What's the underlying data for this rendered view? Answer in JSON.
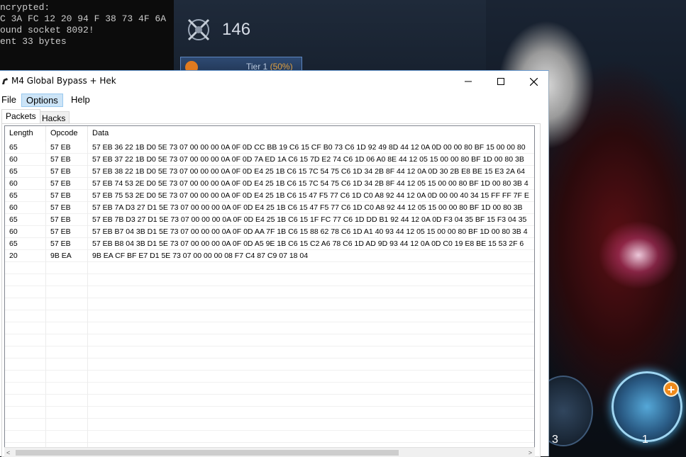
{
  "console": {
    "lines": [
      "ncrypted:",
      "C 3A FC 12 20 94 F 38 73 4F 6A",
      "ound socket 8092!",
      "ent 33 bytes"
    ]
  },
  "game": {
    "crest_count": "146",
    "tier_label": "Tier 1",
    "tier_percent": "(50%)",
    "skill_left_count": "3",
    "skill_right_count": "1",
    "skill_plus": "+"
  },
  "window": {
    "title": "M4 Global Bypass + Hek",
    "menu": {
      "file": "File",
      "options": "Options",
      "help": "Help"
    },
    "tabs": {
      "packets": "Packets",
      "hacks": "Hacks"
    }
  },
  "grid": {
    "headers": {
      "length": "Length",
      "opcode": "Opcode",
      "data": "Data"
    },
    "rows": [
      {
        "length": "65",
        "opcode": "57 EB",
        "data": "57 EB 36 22 1B D0 5E 73 07 00 00 00 0A 0F 0D CC BB 19 C6 15 CF B0 73 C6 1D 92 49 8D 44 12 0A 0D 00 00 80 BF 15 00 00 80"
      },
      {
        "length": "60",
        "opcode": "57 EB",
        "data": "57 EB 37 22 1B D0 5E 73 07 00 00 00 0A 0F 0D 7A ED 1A C6 15 7D E2 74 C6 1D 06 A0 8E 44 12 05 15 00 00 80 BF 1D 00 80 3B"
      },
      {
        "length": "65",
        "opcode": "57 EB",
        "data": "57 EB 38 22 1B D0 5E 73 07 00 00 00 0A 0F 0D E4 25 1B C6 15 7C 54 75 C6 1D 34 2B 8F 44 12 0A 0D 30 2B E8 BE 15 E3 2A 64"
      },
      {
        "length": "60",
        "opcode": "57 EB",
        "data": "57 EB 74 53 2E D0 5E 73 07 00 00 00 0A 0F 0D E4 25 1B C6 15 7C 54 75 C6 1D 34 2B 8F 44 12 05 15 00 00 80 BF 1D 00 80 3B 4"
      },
      {
        "length": "65",
        "opcode": "57 EB",
        "data": "57 EB 75 53 2E D0 5E 73 07 00 00 00 0A 0F 0D E4 25 1B C6 15 47 F5 77 C6 1D C0 A8 92 44 12 0A 0D 00 00 40 34 15 FF FF 7F E"
      },
      {
        "length": "60",
        "opcode": "57 EB",
        "data": "57 EB 7A D3 27 D1 5E 73 07 00 00 00 0A 0F 0D E4 25 1B C6 15 47 F5 77 C6 1D C0 A8 92 44 12 05 15 00 00 80 BF 1D 00 80 3B"
      },
      {
        "length": "65",
        "opcode": "57 EB",
        "data": "57 EB 7B D3 27 D1 5E 73 07 00 00 00 0A 0F 0D E4 25 1B C6 15 1F FC 77 C6 1D DD B1 92 44 12 0A 0D F3 04 35 BF 15 F3 04 35"
      },
      {
        "length": "60",
        "opcode": "57 EB",
        "data": "57 EB B7 04 3B D1 5E 73 07 00 00 00 0A 0F 0D AA 7F 1B C6 15 88 62 78 C6 1D A1 40 93 44 12 05 15 00 00 80 BF 1D 00 80 3B 4"
      },
      {
        "length": "65",
        "opcode": "57 EB",
        "data": "57 EB B8 04 3B D1 5E 73 07 00 00 00 0A 0F 0D A5 9E 1B C6 15 C2 A6 78 C6 1D AD 9D 93 44 12 0A 0D C0 19 E8 BE 15 53 2F 6"
      },
      {
        "length": "20",
        "opcode": "9B EA",
        "data": "9B EA CF BF E7 D1 5E 73 07 00 00 00 08 F7 C4 87 C9 07 18 04"
      }
    ]
  },
  "scrollbar": {
    "left_arrow": "<",
    "right_arrow": ">"
  }
}
